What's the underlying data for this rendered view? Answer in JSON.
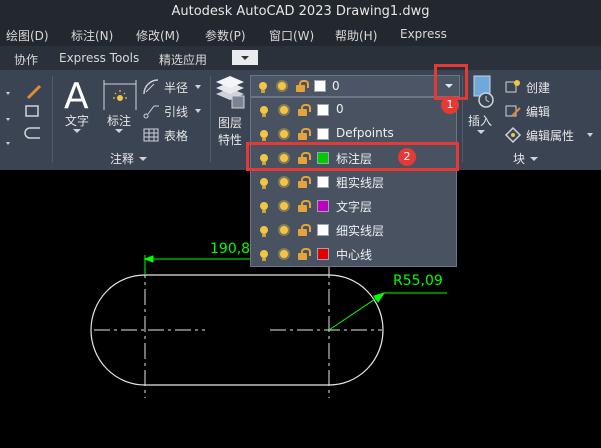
{
  "title": "Autodesk AutoCAD 2023    Drawing1.dwg",
  "menu": [
    "绘图(D)",
    "标注(N)",
    "修改(M)",
    "参数(P)",
    "窗口(W)",
    "帮助(H)",
    "Express"
  ],
  "tabs": [
    "协作",
    "Express Tools",
    "精选应用"
  ],
  "ribbon": {
    "text_label": "文字",
    "dim_label": "标注",
    "radius_label": "半径",
    "leader_label": "引线",
    "table_label": "表格",
    "annotation_panel": "注释",
    "layer_prop_label_1": "图层",
    "layer_prop_label_2": "特性",
    "insert_label": "插入",
    "create_label": "创建",
    "edit_label": "编辑",
    "edit_attr_label": "编辑属性",
    "block_panel": "块"
  },
  "layer_combo": {
    "current": "0"
  },
  "layers": [
    {
      "name": "0",
      "color": "#ffffff"
    },
    {
      "name": "Defpoints",
      "color": "#ffffff"
    },
    {
      "name": "标注层",
      "color": "#00cc00"
    },
    {
      "name": "粗实线层",
      "color": "#ffffff"
    },
    {
      "name": "文字层",
      "color": "#c000c0"
    },
    {
      "name": "细实线层",
      "color": "#ffffff"
    },
    {
      "name": "中心线",
      "color": "#e00000"
    }
  ],
  "badges": {
    "one": "1",
    "two": "2"
  },
  "drawing": {
    "dimension_text": "190,8",
    "radius_text": "R55,09"
  },
  "colors": {
    "dimension": "#00ff00",
    "highlight": "#e53935",
    "geometry": "#e6e6e6"
  }
}
